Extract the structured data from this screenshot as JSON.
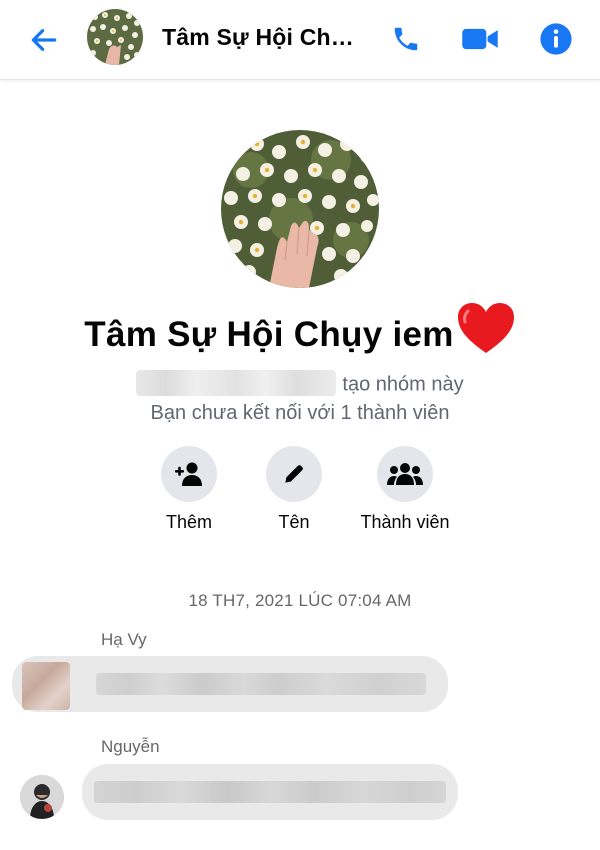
{
  "header": {
    "title": "Tâm Sự Hội Chụy...",
    "back_icon": "arrow-left-icon",
    "call_icon": "phone-icon",
    "video_icon": "video-camera-icon",
    "info_icon": "info-icon",
    "accent_color": "#1877f2"
  },
  "group": {
    "name": "Tâm Sự Hội Chụy iem",
    "name_emoji": "heart-icon",
    "created_suffix": "tạo nhóm này",
    "connection_note": "Bạn chưa kết nối với 1 thành viên"
  },
  "actions": [
    {
      "label": "Thêm",
      "icon": "add-person-icon"
    },
    {
      "label": "Tên",
      "icon": "pencil-icon"
    },
    {
      "label": "Thành viên",
      "icon": "group-members-icon"
    }
  ],
  "timestamp": "18 TH7, 2021 LÚC 07:04 AM",
  "messages": [
    {
      "sender": "Hạ Vy"
    },
    {
      "sender": "Nguyễn"
    }
  ]
}
